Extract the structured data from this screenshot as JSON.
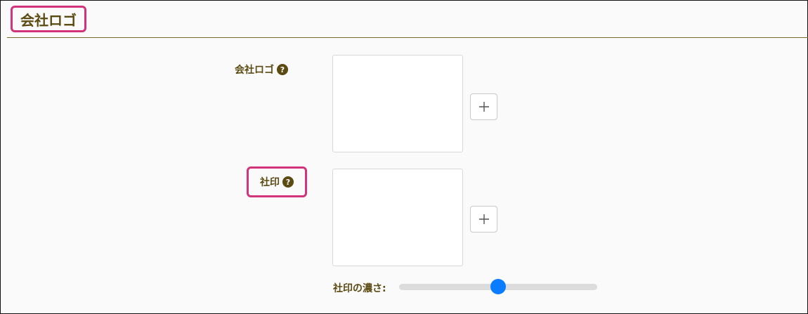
{
  "section": {
    "title": "会社ロゴ"
  },
  "fields": {
    "logo": {
      "label": "会社ロゴ",
      "help": "?",
      "add": "+"
    },
    "seal": {
      "label": "社印",
      "help": "?",
      "add": "+"
    }
  },
  "seal_density": {
    "label": "社印の濃さ:",
    "value_fraction": 0.5
  },
  "colors": {
    "highlight": "#d1347a",
    "label_text": "#5b4a12",
    "slider_accent": "#0a7cff"
  }
}
